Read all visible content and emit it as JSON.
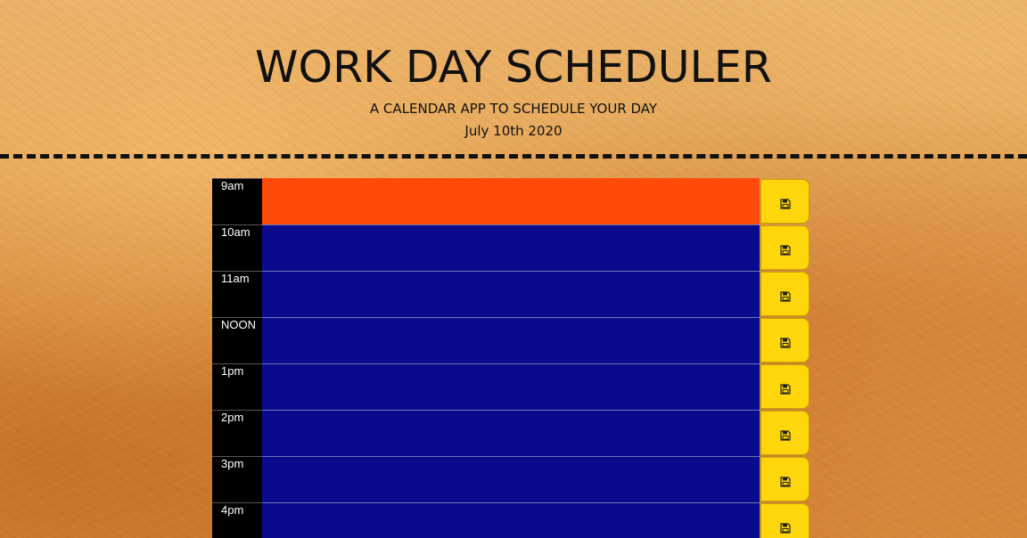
{
  "header": {
    "title": "WORK DAY SCHEDULER",
    "subtitle": "A CALENDAR APP TO SCHEDULE YOUR DAY",
    "date": "July 10th 2020"
  },
  "colors": {
    "present": "#ff4a0a",
    "future": "#0a0a8c",
    "save_button": "#ffd50c",
    "hour_column": "#000000"
  },
  "rows": [
    {
      "hour": "9am",
      "status": "present",
      "text": "",
      "save_icon": "save-icon"
    },
    {
      "hour": "10am",
      "status": "future",
      "text": "",
      "save_icon": "save-icon"
    },
    {
      "hour": "11am",
      "status": "future",
      "text": "",
      "save_icon": "save-icon"
    },
    {
      "hour": "NOON",
      "status": "future",
      "text": "",
      "save_icon": "save-icon"
    },
    {
      "hour": "1pm",
      "status": "future",
      "text": "",
      "save_icon": "save-icon"
    },
    {
      "hour": "2pm",
      "status": "future",
      "text": "",
      "save_icon": "save-icon"
    },
    {
      "hour": "3pm",
      "status": "future",
      "text": "",
      "save_icon": "save-icon"
    },
    {
      "hour": "4pm",
      "status": "future",
      "text": "",
      "save_icon": "save-icon"
    }
  ]
}
